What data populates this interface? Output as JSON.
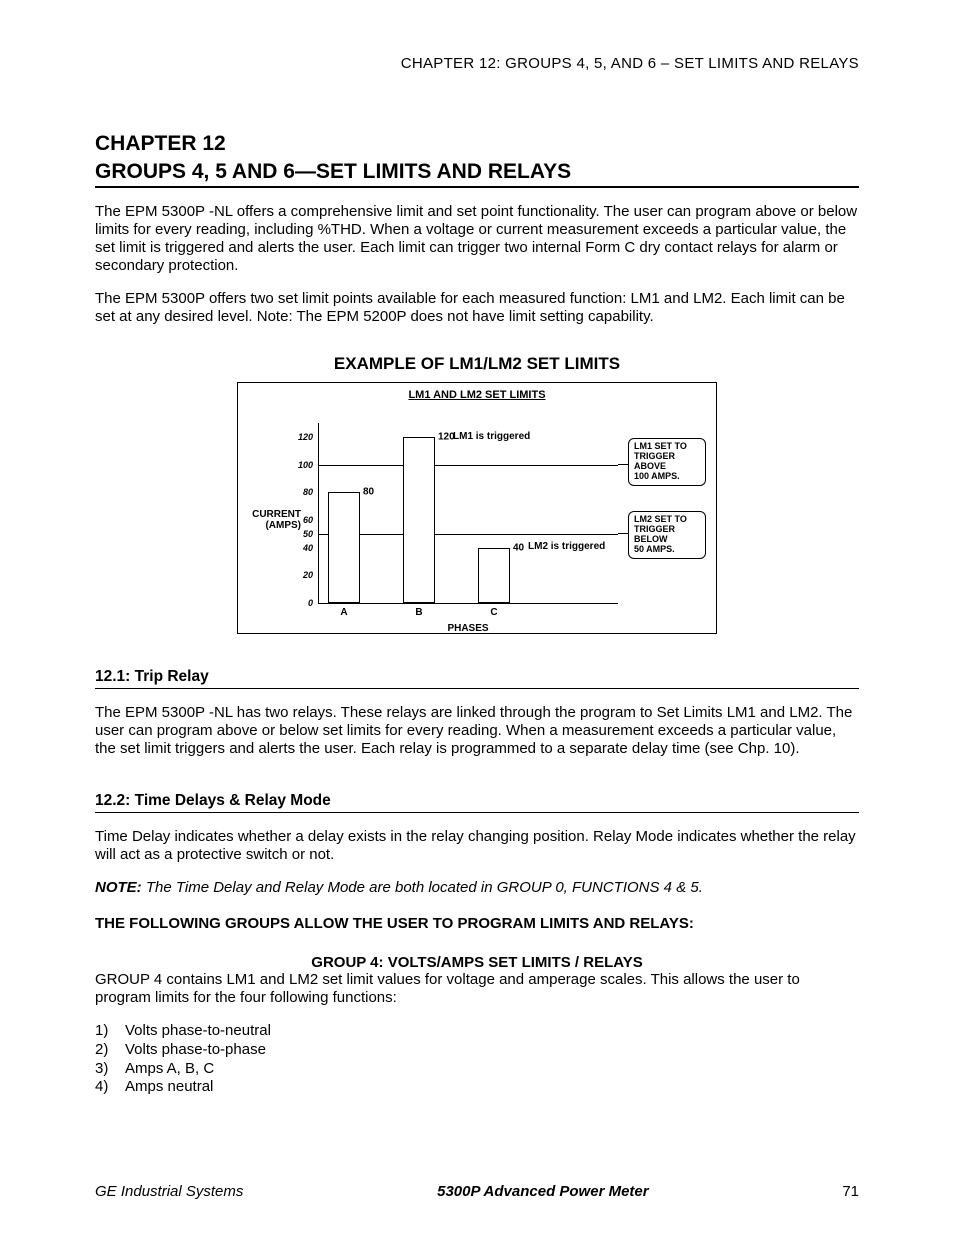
{
  "header": "CHAPTER 12: GROUPS 4, 5, AND 6 – SET LIMITS AND RELAYS",
  "chapter_num": "CHAPTER 12",
  "chapter_title": "GROUPS 4, 5 AND 6—SET LIMITS AND RELAYS",
  "para1": "The EPM 5300P -NL offers a comprehensive limit and set point functionality.  The user can program above or below limits for every reading, including %THD. When a voltage or current measurement exceeds a particular value, the set limit is triggered and alerts the user. Each limit can trigger two internal Form C dry contact relays for alarm or secondary protection.",
  "para2": "The EPM 5300P offers two set limit points available for each measured function: LM1 and LM2. Each limit can be set at any desired level. Note: The EPM 5200P does not have limit setting capability.",
  "example_title": "EXAMPLE OF LM1/LM2 SET LIMITS",
  "chart_data": {
    "type": "bar",
    "title": "LM1 AND LM2 SET LIMITS",
    "ylabel_line1": "CURRENT",
    "ylabel_line2": "(AMPS)",
    "xlabel": "PHASES",
    "categories": [
      "A",
      "B",
      "C"
    ],
    "values": [
      80,
      120,
      40
    ],
    "yticks": [
      "0",
      "20",
      "40",
      "50",
      "60",
      "80",
      "100",
      "120"
    ],
    "ylim": [
      0,
      130
    ],
    "lm1_limit": 100,
    "lm2_limit": 50,
    "lm1_trigger_text": "LM1 is triggered",
    "lm2_trigger_text": "LM2 is triggered",
    "callout1_l1": "LM1 SET TO",
    "callout1_l2": "TRIGGER ABOVE",
    "callout1_l3": "100 AMPS.",
    "callout2_l1": "LM2 SET TO",
    "callout2_l2": "TRIGGER BELOW",
    "callout2_l3": "50 AMPS.",
    "bar_a_label": "80",
    "bar_b_label": "120",
    "bar_c_label": "40"
  },
  "section1_heading": "12.1: Trip Relay",
  "section1_body": "The EPM 5300P -NL has two relays.  These relays are linked through the program to Set Limits LM1 and LM2.  The user can program above or below set limits for every reading.  When a measurement exceeds a particular value, the set limit triggers and alerts the user.  Each relay is programmed to a separate delay time (see Chp. 10).",
  "section2_heading": "12.2: Time Delays & Relay Mode",
  "section2_body": "Time Delay indicates whether a delay exists in the relay changing position.  Relay Mode indicates whether the relay will act as a protective switch or not.",
  "note_label": "NOTE:",
  "note_text": " The Time Delay and Relay Mode are both located in GROUP 0, FUNCTIONS 4 & 5.",
  "bold_intro": "THE FOLLOWING GROUPS ALLOW THE USER TO PROGRAM LIMITS AND RELAYS:",
  "group4_heading": "GROUP 4:  VOLTS/AMPS SET LIMITS / RELAYS",
  "group4_body": "GROUP 4 contains LM1 and LM2 set limit values for voltage and amperage scales. This allows the user to program limits for the four following functions:",
  "list": [
    {
      "num": "1)",
      "text": "Volts phase-to-neutral"
    },
    {
      "num": "2)",
      "text": "Volts phase-to-phase"
    },
    {
      "num": "3)",
      "text": "Amps A, B, C"
    },
    {
      "num": "4)",
      "text": "Amps neutral"
    }
  ],
  "footer_left": "GE Industrial Systems",
  "footer_center": "5300P  Advanced Power Meter",
  "footer_right": "71"
}
